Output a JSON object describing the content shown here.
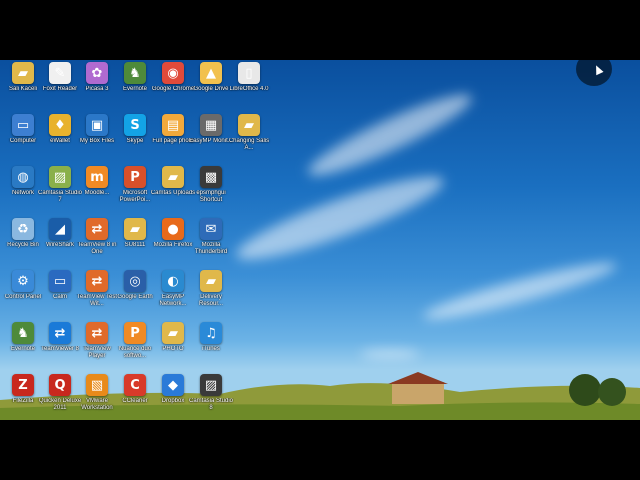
{
  "desktop": {
    "icons": [
      {
        "label": "Sali Kaceli",
        "icon": "folder-icon",
        "color": "#e0b84a"
      },
      {
        "label": "Foxit Reader",
        "icon": "foxit-reader-icon",
        "color": "#f0f0f0"
      },
      {
        "label": "Picasa 3",
        "icon": "picasa-icon",
        "color": "#b06ad0"
      },
      {
        "label": "Evernote",
        "icon": "evernote-icon",
        "color": "#4e8a3a"
      },
      {
        "label": "Google Chrome",
        "icon": "chrome-icon",
        "color": "#e04a3a"
      },
      {
        "label": "Google Drive",
        "icon": "google-drive-icon",
        "color": "#f2c14e"
      },
      {
        "label": "LibreOffice 4.0",
        "icon": "libreoffice-icon",
        "color": "#e8e8e8"
      },
      {
        "label": "Computer",
        "icon": "computer-icon",
        "color": "#3d7fd1"
      },
      {
        "label": "eWallet",
        "icon": "ewallet-icon",
        "color": "#e8b22d"
      },
      {
        "label": "My Box Files",
        "icon": "box-files-icon",
        "color": "#2b78c8"
      },
      {
        "label": "Skype",
        "icon": "skype-icon",
        "color": "#13a3e6"
      },
      {
        "label": "Full page photo",
        "icon": "screenshot-icon",
        "color": "#f2a93b"
      },
      {
        "label": "EasyMP Monit...",
        "icon": "easymp-icon",
        "color": "#6a6a6a"
      },
      {
        "label": "Changing Salis A...",
        "icon": "folder-icon",
        "color": "#e0b84a"
      },
      {
        "label": "Network",
        "icon": "network-icon",
        "color": "#2a7ac4"
      },
      {
        "label": "Camtasia Studio 7",
        "icon": "camtasia-icon",
        "color": "#8ab04a"
      },
      {
        "label": "Moodle...",
        "icon": "moodle-icon",
        "color": "#f08a24"
      },
      {
        "label": "Microsoft PowerPoi...",
        "icon": "powerpoint-icon",
        "color": "#d8502a"
      },
      {
        "label": "Camtas Uploads",
        "icon": "folder-icon",
        "color": "#e0b84a"
      },
      {
        "label": "epsmphgui Shortcut",
        "icon": "epson-icon",
        "color": "#3a3a3a"
      },
      {
        "label": "",
        "icon": "",
        "color": ""
      },
      {
        "label": "Recycle Bin",
        "icon": "recycle-bin-icon",
        "color": "#8ab8e0"
      },
      {
        "label": "WireShark",
        "icon": "wireshark-icon",
        "color": "#1a5da8"
      },
      {
        "label": "TeamView 8 in One",
        "icon": "teamviewer-icon",
        "color": "#e06a2a"
      },
      {
        "label": "SU8111",
        "icon": "folder-icon",
        "color": "#e0b84a"
      },
      {
        "label": "Mozilla Firefox",
        "icon": "firefox-icon",
        "color": "#e86a1a"
      },
      {
        "label": "Mozilla Thunderbird",
        "icon": "thunderbird-icon",
        "color": "#2e6bb8"
      },
      {
        "label": "",
        "icon": "",
        "color": ""
      },
      {
        "label": "Control Panel",
        "icon": "control-panel-icon",
        "color": "#3a8ad8"
      },
      {
        "label": "Calm",
        "icon": "calm-icon",
        "color": "#2a6ac0"
      },
      {
        "label": "TeamView Test Wit...",
        "icon": "teamviewer-icon",
        "color": "#e06a2a"
      },
      {
        "label": "Google Earth",
        "icon": "google-earth-icon",
        "color": "#2a5fa8"
      },
      {
        "label": "EasyMP Network...",
        "icon": "easymp-network-icon",
        "color": "#2a8ad0"
      },
      {
        "label": "Delivery Resour...",
        "icon": "folder-icon",
        "color": "#e0b84a"
      },
      {
        "label": "",
        "icon": "",
        "color": ""
      },
      {
        "label": "Evernote",
        "icon": "evernote-icon",
        "color": "#4e8a3a"
      },
      {
        "label": "TeamViewer 8",
        "icon": "teamviewer-icon",
        "color": "#1a7ad8"
      },
      {
        "label": "TeamView Player",
        "icon": "teamviewer-icon",
        "color": "#e06a2a"
      },
      {
        "label": "Nuance duo softwo...",
        "icon": "nuance-icon",
        "color": "#f08a24"
      },
      {
        "label": "PHOTO",
        "icon": "folder-icon",
        "color": "#e0b84a"
      },
      {
        "label": "iTunes",
        "icon": "itunes-icon",
        "color": "#2a8ad8"
      },
      {
        "label": "",
        "icon": "",
        "color": ""
      },
      {
        "label": "FileZilla",
        "icon": "filezilla-icon",
        "color": "#c8281e"
      },
      {
        "label": "Quicken Deluxe 2011",
        "icon": "quicken-icon",
        "color": "#c8281e"
      },
      {
        "label": "VMware Workstation",
        "icon": "vmware-icon",
        "color": "#e88a1a"
      },
      {
        "label": "CCleaner",
        "icon": "ccleaner-icon",
        "color": "#d83a2a"
      },
      {
        "label": "Dropbox",
        "icon": "dropbox-icon",
        "color": "#2a7ad8"
      },
      {
        "label": "Camtasia Studio 8",
        "icon": "camtasia-icon",
        "color": "#3a3a3a"
      },
      {
        "label": "",
        "icon": "",
        "color": ""
      }
    ]
  }
}
